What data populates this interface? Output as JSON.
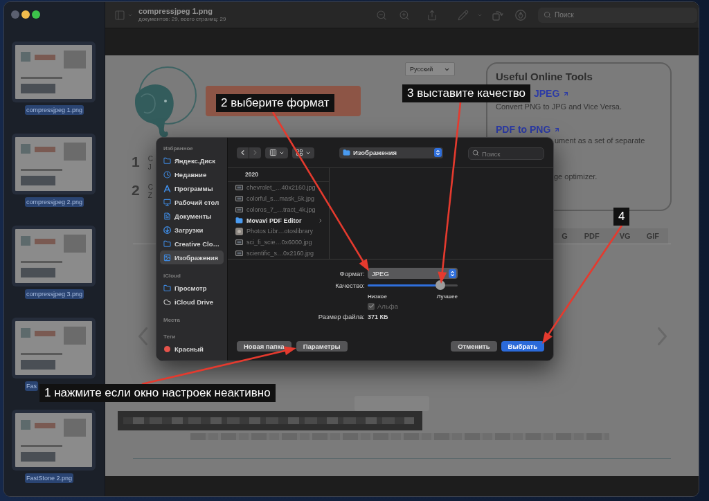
{
  "window": {
    "controls": [
      {
        "color": "#5b6070"
      },
      {
        "color": "#f2bd4d"
      },
      {
        "color": "#3cc24b"
      }
    ]
  },
  "sidebar": {
    "thumbnails": [
      {
        "label": "compressjpeg 1.png",
        "selected": true
      },
      {
        "label": "compressjpeg 2.png",
        "selected": true
      },
      {
        "label": "compressjpeg 3.png",
        "selected": true
      },
      {
        "label": "Fas",
        "selected": true
      },
      {
        "label": "FastStone 2.png",
        "selected": true
      }
    ]
  },
  "toolbar": {
    "title": "compressjpeg 1.png",
    "subtitle": "документов: 29, всего страниц: 29",
    "search": {
      "placeholder": "Поиск"
    }
  },
  "document": {
    "language_select": {
      "value": "Русский"
    },
    "steps": [
      {
        "number": "1",
        "lines": [
          "C",
          "J"
        ]
      },
      {
        "number": "2",
        "lines": [
          "C",
          "Z"
        ]
      }
    ],
    "tools_card": {
      "heading": "Useful Online Tools",
      "entries": [
        {
          "kind": "link",
          "text": "JPEG"
        },
        {
          "kind": "text",
          "text": "Convert PNG to JPG and Vice Versa."
        },
        {
          "kind": "link",
          "text": "PDF to PNG"
        },
        {
          "kind": "text",
          "text": "ument as a set of separate"
        },
        {
          "kind": "text",
          "text": "ge optimizer."
        }
      ]
    },
    "format_tabs": [
      "G",
      "PDF",
      "VG",
      "GIF"
    ]
  },
  "dialog": {
    "sidebar": {
      "sections": [
        {
          "heading": "Избранное",
          "items": [
            {
              "label": "Яндекс.Диск",
              "kind": "folder",
              "selected": false
            },
            {
              "label": "Недавние",
              "kind": "recents",
              "selected": false
            },
            {
              "label": "Программы",
              "kind": "applications",
              "selected": false
            },
            {
              "label": "Рабочий стол",
              "kind": "desktop",
              "selected": false
            },
            {
              "label": "Документы",
              "kind": "documents",
              "selected": false
            },
            {
              "label": "Загрузки",
              "kind": "downloads",
              "selected": false
            },
            {
              "label": "Creative Clo…",
              "kind": "folder",
              "selected": false
            },
            {
              "label": "Изображения",
              "kind": "pictures",
              "selected": true
            }
          ]
        },
        {
          "heading": "iCloud",
          "items": [
            {
              "label": "Просмотр",
              "kind": "folder",
              "selected": false
            },
            {
              "label": "iCloud Drive",
              "kind": "cloud",
              "selected": false
            }
          ]
        },
        {
          "heading": "Места"
        },
        {
          "heading": "Теги",
          "items": [
            {
              "label": "Красный",
              "kind": "tag",
              "color": "#e5534b",
              "selected": false
            }
          ]
        }
      ]
    },
    "navigation": {
      "back": {
        "disabled": false
      },
      "forward": {
        "disabled": true
      }
    },
    "location": {
      "value": "Изображения"
    },
    "search": {
      "placeholder": "Поиск"
    },
    "column": {
      "heading": "2020",
      "files": [
        {
          "name": "chevrolet_…40x2160.jpg",
          "kind": "image",
          "disabled": true
        },
        {
          "name": "colorful_s…mask_5k.jpg",
          "kind": "image",
          "disabled": true
        },
        {
          "name": "coloros_7_…tract_4k.jpg",
          "kind": "image",
          "disabled": true
        },
        {
          "name": "Movavi PDF Editor",
          "kind": "folder",
          "disabled": false
        },
        {
          "name": "Photos Libr…otoslibrary",
          "kind": "library",
          "disabled": true
        },
        {
          "name": "sci_fi_scie…0x6000.jpg",
          "kind": "image",
          "disabled": true
        },
        {
          "name": "scientific_s…0x2160.jpg",
          "kind": "image",
          "disabled": true
        }
      ]
    },
    "options": {
      "format": {
        "label": "Формат:",
        "value": "JPEG"
      },
      "quality": {
        "label": "Качество:",
        "level": 0.81,
        "min_label": "Низкое",
        "max_label": "Лучшее"
      },
      "alpha": {
        "label": "Альфа",
        "checked": true,
        "disabled": true
      },
      "file_size": {
        "label": "Размер файла:",
        "value": "371 КБ"
      }
    },
    "buttons_left": [
      {
        "label": "Новая папка"
      },
      {
        "label": "Параметры"
      }
    ],
    "buttons_right": [
      {
        "label": "Отменить",
        "default": false
      },
      {
        "label": "Выбрать",
        "default": true
      }
    ]
  },
  "annotations": [
    {
      "text": "1 нажмите если окно настроек неактивно"
    },
    {
      "text": "2 выберите формат"
    },
    {
      "text": "3 выставите качество"
    },
    {
      "text": "4"
    }
  ]
}
